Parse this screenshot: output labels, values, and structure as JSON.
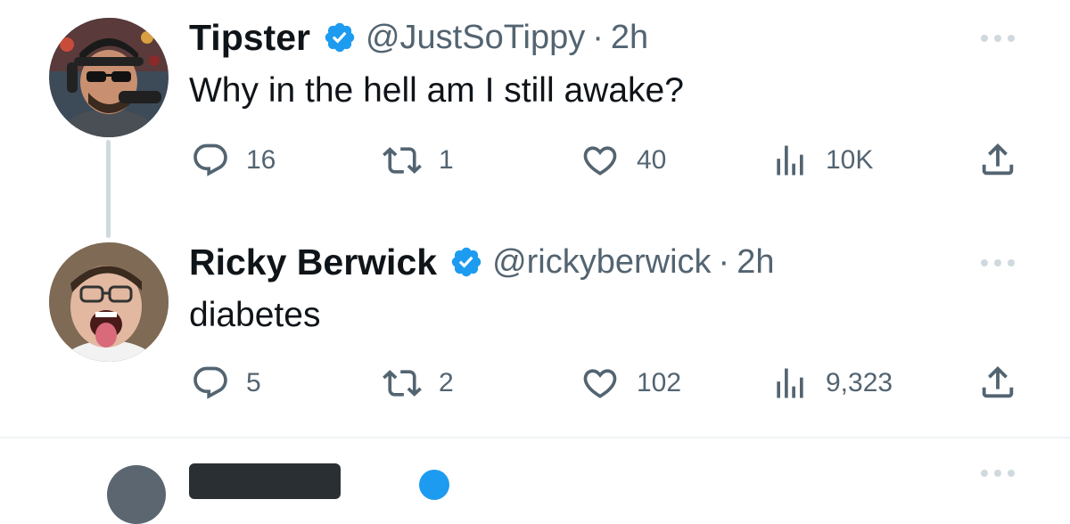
{
  "tweets": [
    {
      "name": "Tipster",
      "handle": "@JustSoTippy",
      "separator": "·",
      "time": "2h",
      "text": "Why in the hell am I still awake?",
      "replies": "16",
      "retweets": "1",
      "likes": "40",
      "views": "10K"
    },
    {
      "name": "Ricky Berwick",
      "handle": "@rickyberwick",
      "separator": "·",
      "time": "2h",
      "text": "diabetes",
      "replies": "5",
      "retweets": "2",
      "likes": "102",
      "views": "9,323"
    }
  ],
  "icons": {
    "verified": "verified-badge-icon",
    "more": "more-options-icon",
    "reply": "reply-icon",
    "retweet": "retweet-icon",
    "like": "like-heart-icon",
    "views": "views-bar-chart-icon",
    "share": "share-upload-icon"
  },
  "colors": {
    "verified": "#1d9bf0",
    "secondary_text": "#536471",
    "primary_text": "#0f1419",
    "thread_line": "#cfd9de",
    "divider": "#eff3f4"
  }
}
